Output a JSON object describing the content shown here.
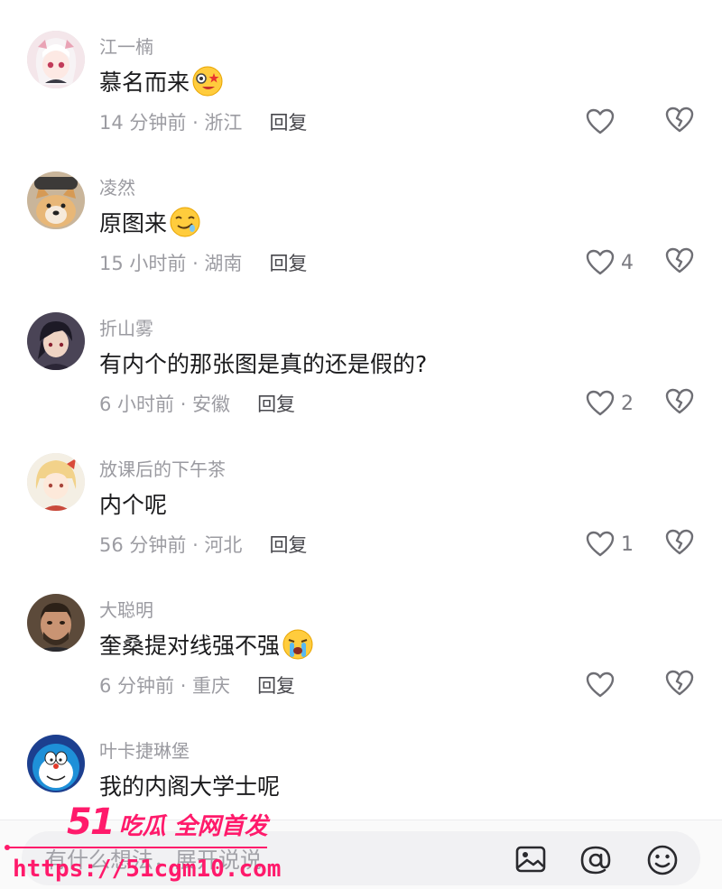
{
  "comments": [
    {
      "username": "江一楠",
      "text": "慕名而来",
      "emoji": "star-eyes-emoji",
      "time": "14 分钟前 · 浙江",
      "reply": "回复",
      "likes": "",
      "avatar": "anime-girl-white-hair"
    },
    {
      "username": "凌然",
      "text": "原图来",
      "emoji": "drool-emoji",
      "time": "15 小时前 · 湖南",
      "reply": "回复",
      "likes": "4",
      "avatar": "shiba-dog"
    },
    {
      "username": "折山雾",
      "text": "有内个的那张图是真的还是假的?",
      "emoji": "",
      "time": "6 小时前 · 安徽",
      "reply": "回复",
      "likes": "2",
      "avatar": "anime-boy-dark-hair"
    },
    {
      "username": "放课后的下午茶",
      "text": "内个呢",
      "emoji": "",
      "time": "56 分钟前 · 河北",
      "reply": "回复",
      "likes": "1",
      "avatar": "anime-girl-blonde"
    },
    {
      "username": "大聪明",
      "text": "奎桑提对线强不强",
      "emoji": "crying-emoji",
      "time": "6 分钟前 · 重庆",
      "reply": "回复",
      "likes": "",
      "avatar": "man-photo"
    },
    {
      "username": "叶卡捷琳堡",
      "text": "我的内阁大学士呢",
      "emoji": "",
      "time": "",
      "reply": "",
      "likes": "",
      "avatar": "doraemon"
    }
  ],
  "input": {
    "placeholder": "有什么想法，展开说说"
  },
  "watermark": {
    "brand_num": "51",
    "brand_text": "吃瓜 全网首发",
    "url": "https://51cgm10.com"
  },
  "colors": {
    "accent": "#ff1a6b",
    "meta": "#9c9ca2",
    "text": "#1b1b1d"
  }
}
